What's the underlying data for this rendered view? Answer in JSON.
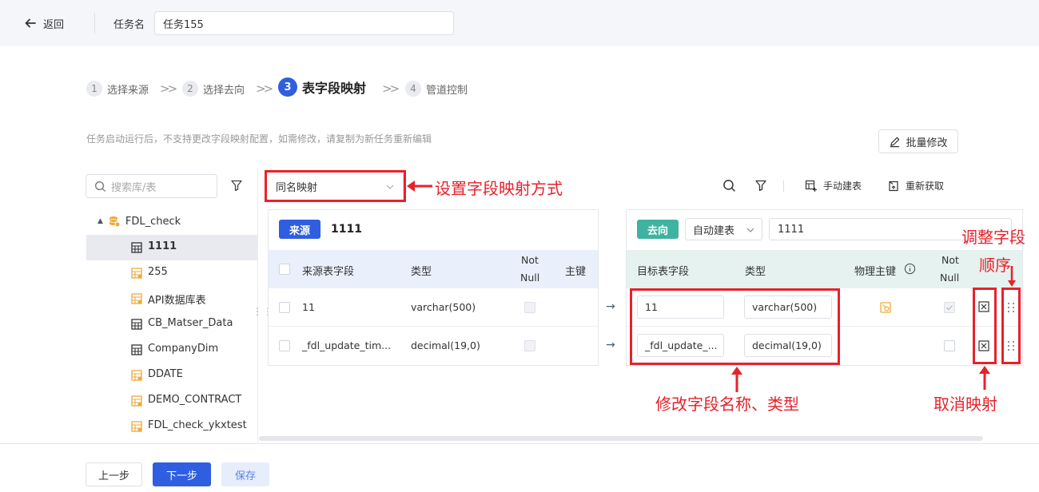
{
  "header": {
    "back_label": "返回",
    "task_label": "任务名",
    "task_value": "任务155"
  },
  "steps": [
    {
      "num": "1",
      "label": "选择来源"
    },
    {
      "num": "2",
      "label": "选择去向"
    },
    {
      "num": "3",
      "label": "表字段映射"
    },
    {
      "num": "4",
      "label": "管道控制"
    }
  ],
  "notice": "任务启动运行后，不支持更改字段映射配置，如需修改，请复制为新任务重新编辑",
  "batch_edit_label": "批量修改",
  "left": {
    "search_placeholder": "搜索库/表",
    "root_label": "FDL_check",
    "tables": [
      {
        "label": "1111",
        "icon": "table-grid-icon",
        "selected": true
      },
      {
        "label": "255",
        "icon": "table-orange-icon"
      },
      {
        "label": "API数据库表",
        "icon": "table-orange-icon"
      },
      {
        "label": "CB_Matser_Data",
        "icon": "table-grid-icon"
      },
      {
        "label": "CompanyDim",
        "icon": "table-grid-icon"
      },
      {
        "label": "DDATE",
        "icon": "table-orange-icon"
      },
      {
        "label": "DEMO_CONTRACT",
        "icon": "table-orange-icon"
      },
      {
        "label": "FDL_check_ykxtest",
        "icon": "table-orange-icon"
      }
    ]
  },
  "mapping_mode": "同名映射",
  "toolbar": {
    "manual_create": "手动建表",
    "refetch": "重新获取"
  },
  "source": {
    "tag": "来源",
    "table_name": "1111",
    "columns": {
      "field": "来源表字段",
      "type": "类型",
      "notnull_1": "Not",
      "notnull_2": "Null",
      "pk": "主键"
    },
    "rows": [
      {
        "field": "11",
        "type": "varchar(500)"
      },
      {
        "field": "_fdl_update_tim...",
        "type": "decimal(19,0)"
      }
    ]
  },
  "target": {
    "tag": "去向",
    "create_mode": "自动建表",
    "table_name": "1111",
    "columns": {
      "field": "目标表字段",
      "type": "类型",
      "pk": "物理主键",
      "notnull_1": "Not",
      "notnull_2": "Null"
    },
    "rows": [
      {
        "field": "11",
        "type": "varchar(500)"
      },
      {
        "field": "_fdl_update_...",
        "type": "decimal(19,0)"
      }
    ]
  },
  "annotations": {
    "mapping_mode": "设置字段映射方式",
    "adjust_1": "调整字段",
    "adjust_2": "顺序",
    "modify": "修改字段名称、类型",
    "cancel": "取消映射"
  },
  "footer": {
    "prev": "上一步",
    "next": "下一步",
    "save": "保存"
  },
  "colors": {
    "primary": "#2f5ee0",
    "source_tag": "#2f5ee0",
    "target_tag": "#3fb3a0",
    "annotation": "#e8212b"
  }
}
